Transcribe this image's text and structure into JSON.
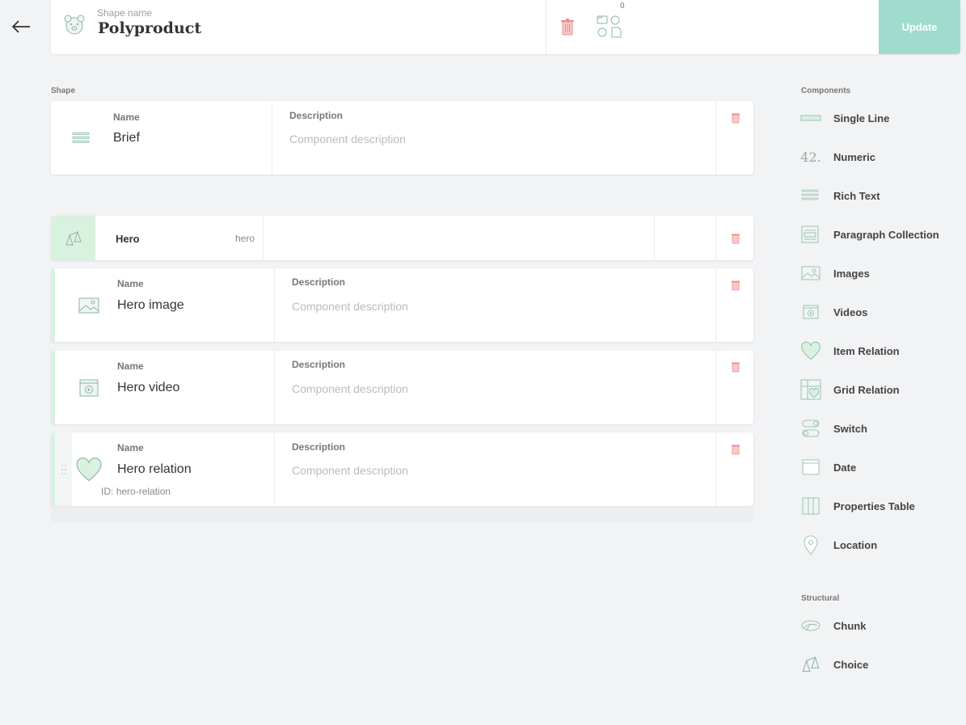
{
  "header": {
    "shape_label": "Shape name",
    "shape_name": "Polyproduct",
    "items_count": "0",
    "update_label": "Update"
  },
  "shape_section": {
    "label": "Shape",
    "brief": {
      "name_label": "Name",
      "name_value": "Brief",
      "desc_label": "Description",
      "desc_placeholder": "Component description"
    }
  },
  "chunk": {
    "name": "Hero",
    "id": "hero",
    "children": [
      {
        "name_label": "Name",
        "name_value": "Hero image",
        "desc_label": "Description",
        "desc_placeholder": "Component description"
      },
      {
        "name_label": "Name",
        "name_value": "Hero video",
        "desc_label": "Description",
        "desc_placeholder": "Component description"
      },
      {
        "name_label": "Name",
        "name_value": "Hero relation",
        "desc_label": "Description",
        "desc_placeholder": "Component description",
        "id_label": "ID:",
        "id_value": "hero-relation"
      }
    ]
  },
  "sidebar": {
    "components_label": "Components",
    "components": [
      {
        "label": "Single Line",
        "icon": "single-line-icon"
      },
      {
        "label": "Numeric",
        "icon": "numeric-icon",
        "icon_text": "42."
      },
      {
        "label": "Rich Text",
        "icon": "rich-text-icon"
      },
      {
        "label": "Paragraph Collection",
        "icon": "paragraph-collection-icon"
      },
      {
        "label": "Images",
        "icon": "images-icon"
      },
      {
        "label": "Videos",
        "icon": "videos-icon"
      },
      {
        "label": "Item Relation",
        "icon": "item-relation-icon"
      },
      {
        "label": "Grid Relation",
        "icon": "grid-relation-icon"
      },
      {
        "label": "Switch",
        "icon": "switch-icon"
      },
      {
        "label": "Date",
        "icon": "date-icon"
      },
      {
        "label": "Properties Table",
        "icon": "properties-table-icon"
      },
      {
        "label": "Location",
        "icon": "location-icon"
      }
    ],
    "structural_label": "Structural",
    "structural": [
      {
        "label": "Chunk",
        "icon": "chunk-icon"
      },
      {
        "label": "Choice",
        "icon": "choice-icon"
      }
    ]
  },
  "colors": {
    "accent": "#9fdccd",
    "icon_stroke": "#8bb5a8",
    "trash": "#f0a3a3",
    "chunk_bg": "#d9f1df"
  }
}
